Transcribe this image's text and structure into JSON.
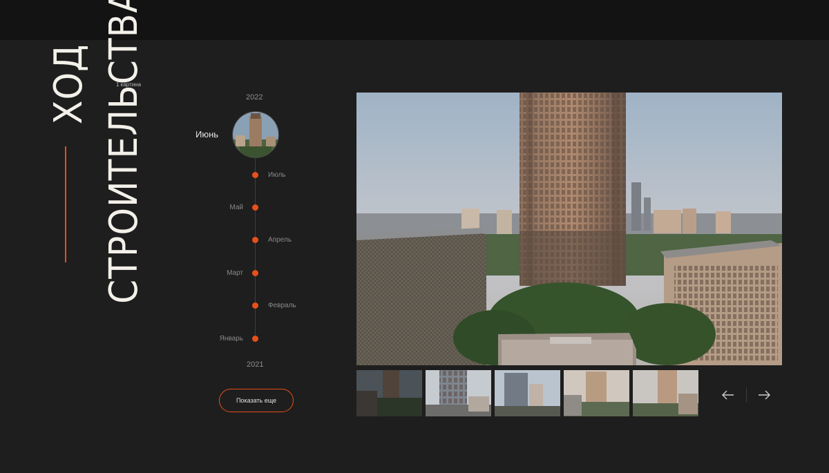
{
  "title": {
    "line1": "ХОД",
    "line2": "СТРОИТЕЛЬСТВА"
  },
  "photo_note": "1 картина",
  "timeline": {
    "year_top": "2022",
    "year_bottom": "2021",
    "current_month": "Июнь",
    "months": [
      "Июль",
      "Май",
      "Апрель",
      "Март",
      "Февраль",
      "Январь"
    ]
  },
  "show_more_label": "Показать еще",
  "colors": {
    "accent": "#e8501b",
    "background": "#1e1e1e",
    "topbar": "#131313"
  },
  "icons": {
    "prev": "arrow-left-icon",
    "next": "arrow-right-icon"
  }
}
